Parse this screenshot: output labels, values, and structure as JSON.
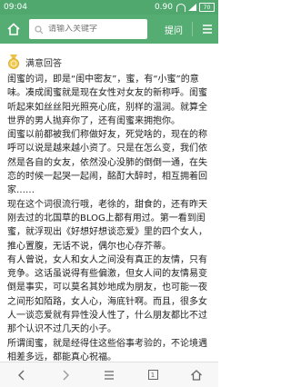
{
  "status_bar": {
    "time": "09:04",
    "speed": "0.90",
    "battery": "70"
  },
  "header": {
    "search_placeholder": "请输入关键字",
    "ask_label": "提问"
  },
  "answer": {
    "label": "满意回答"
  },
  "content": {
    "paragraphs": [
      "闺蜜的词，即是“闺中密友”，蜜，有“小蜜”的意味。凑成闺蜜就是现在女性对女友的新称呼。闺蜜听起来如丝丝阳光照亮心底，别样的温润。就算全世界的男人抛弃你了，还有闺蜜来拥抱你。",
      "闺蜜以前都被我们称做好友，死党啥的，现在的称呼可以说是越来越小资了。只是在怎么变，我们依然是各自的女友，依然没心没肺的倒倒一通，在失恋的时候一起哭一起闹，酩酊大醉时，相互拥着回家……",
      "现在这个词很流行哦，老徐的，甜食的，还有昨天刚去过的北国草的BLOG上都有用过。第一看到闺蜜，就浮现出《好想好想谈恋爱》里的四个女人，推心置腹，无话不说，偶尔也心存芥蒂。",
      "有人曾说，女人和女人之间没有真正的友情，只有竞争。这话虽说得有些偏激，但女人间的友情易变倒是事实，可以莫名其妙地成为朋友，也可能一夜之间形如陌路，女人心，海底针啊。而且，很多女人一谈恋爱就有异性没人性了，什么朋友都比不过那个认识不过几天的小子。",
      "所谓闺蜜，就是经得住这些俗事考验的，不论境遇相差多远，都能真心祝福。"
    ]
  }
}
